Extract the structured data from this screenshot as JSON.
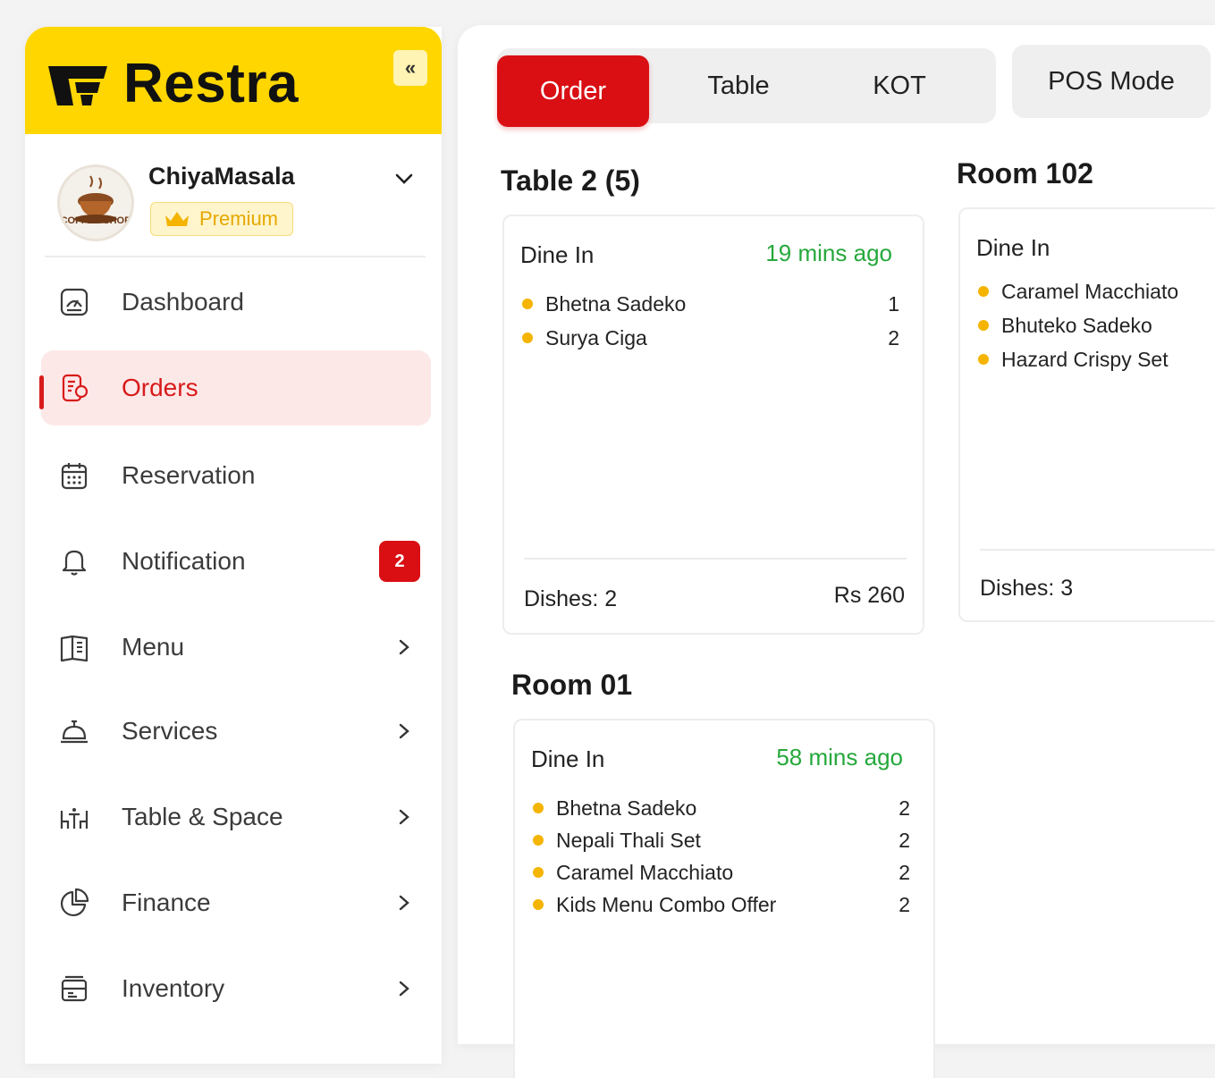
{
  "brand": {
    "name": "Restra",
    "collapse_glyph": "«"
  },
  "account": {
    "name": "ChiyaMasala",
    "plan": "Premium",
    "avatar_text": "COFFEE SHOP"
  },
  "sidebar": {
    "items": [
      {
        "label": "Dashboard",
        "icon": "dashboard-icon"
      },
      {
        "label": "Orders",
        "icon": "orders-icon",
        "active": true
      },
      {
        "label": "Reservation",
        "icon": "calendar-icon"
      },
      {
        "label": "Notification",
        "icon": "bell-icon",
        "badge": "2"
      },
      {
        "label": "Menu",
        "icon": "book-icon"
      },
      {
        "label": "Services",
        "icon": "service-bell-icon"
      },
      {
        "label": "Table & Space",
        "icon": "table-chairs-icon"
      },
      {
        "label": "Finance",
        "icon": "pie-chart-icon"
      },
      {
        "label": "Inventory",
        "icon": "inventory-icon"
      }
    ]
  },
  "tabs": [
    {
      "label": "Order",
      "active": true
    },
    {
      "label": "Table"
    },
    {
      "label": "KOT"
    }
  ],
  "pos_mode_label": "POS Mode",
  "orders": [
    {
      "title": "Table 2 (5)",
      "type": "Dine In",
      "time": "19 mins ago",
      "items": [
        {
          "name": "Bhetna Sadeko",
          "qty": "1"
        },
        {
          "name": "Surya Ciga",
          "qty": "2"
        }
      ],
      "dishes": "Dishes: 2",
      "total": "Rs 260"
    },
    {
      "title": "Room 102",
      "type": "Dine In",
      "items": [
        {
          "name": "Caramel Macchiato"
        },
        {
          "name": "Bhuteko Sadeko"
        },
        {
          "name": "Hazard Crispy Set"
        }
      ],
      "dishes": "Dishes: 3"
    },
    {
      "title": "Room 01",
      "type": "Dine In",
      "time": "58 mins ago",
      "items": [
        {
          "name": "Bhetna Sadeko",
          "qty": "2"
        },
        {
          "name": "Nepali Thali Set",
          "qty": "2"
        },
        {
          "name": "Caramel Macchiato",
          "qty": "2"
        },
        {
          "name": "Kids Menu Combo Offer",
          "qty": "2"
        }
      ]
    }
  ],
  "colors": {
    "brand_yellow": "#ffd600",
    "accent_red": "#d90f14",
    "active_bg": "#fde8e8",
    "time_green": "#26a83c",
    "dot_yellow": "#f4b400"
  }
}
